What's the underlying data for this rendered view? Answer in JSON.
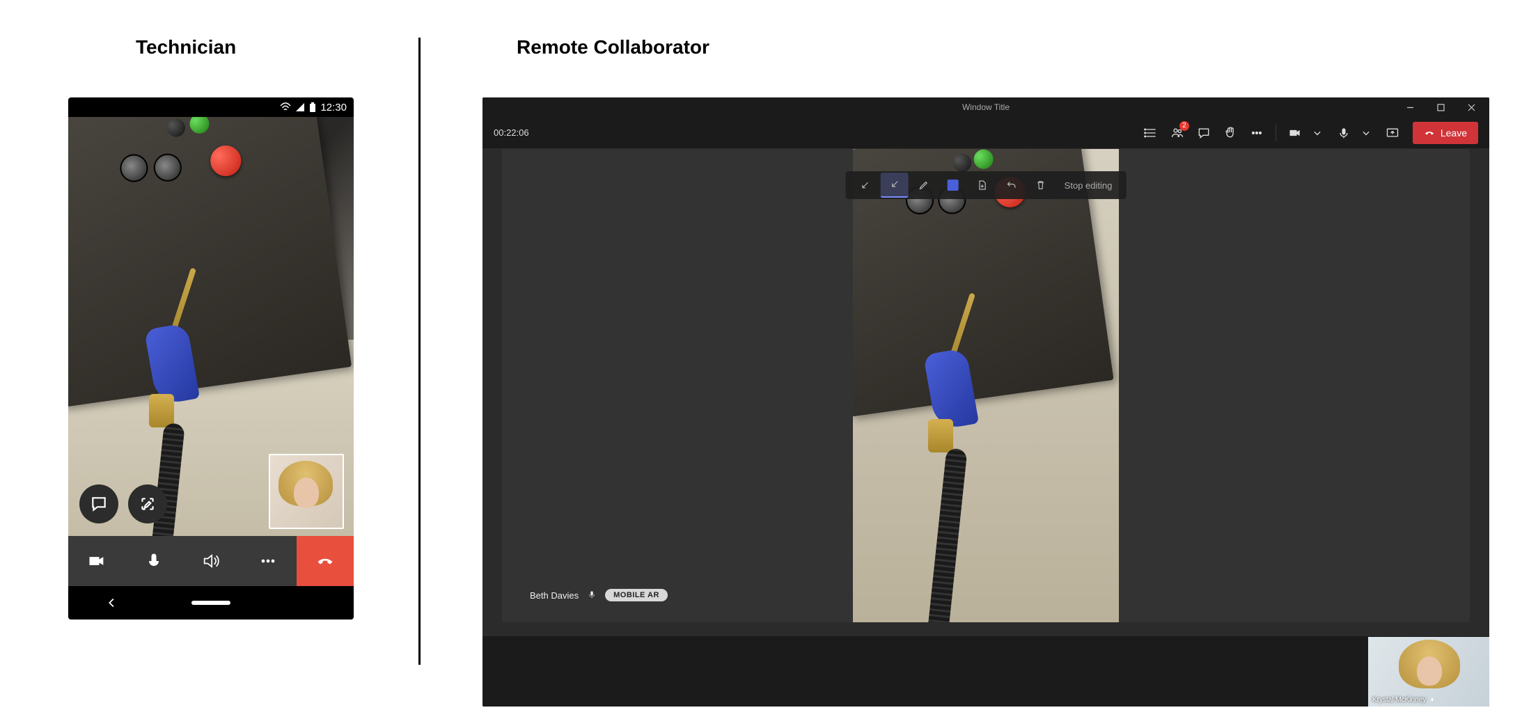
{
  "labels": {
    "technician": "Technician",
    "remote": "Remote Collaborator"
  },
  "phone": {
    "status_time": "12:30",
    "icons": {
      "chat": "chat-icon",
      "annotate": "annotate-icon"
    },
    "callbar": {
      "video": "video-icon",
      "mic": "mic-icon",
      "speaker": "speaker-icon",
      "more": "more-icon",
      "hangup": "hangup-icon"
    }
  },
  "desktop": {
    "window_title": "Window Title",
    "call_timer": "00:22:06",
    "toolbar": {
      "people_badge": "2",
      "leave_label": "Leave"
    },
    "edit_toolbar": {
      "stop_label": "Stop editing"
    },
    "participant": {
      "name": "Beth Davies",
      "badge": "MOBILE AR"
    },
    "pip": {
      "name": "Krystal McKinney"
    }
  }
}
